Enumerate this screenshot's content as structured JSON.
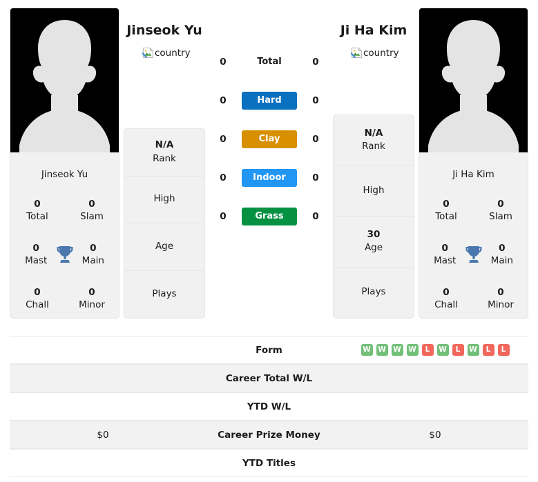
{
  "players": {
    "left": {
      "name": "Jinseok Yu",
      "flag_alt": "country",
      "avatar_name": "player-silhouette",
      "info": [
        {
          "value": "N/A",
          "caption": "Rank"
        },
        {
          "value": "",
          "caption": "High"
        },
        {
          "value": "",
          "caption": "Age"
        },
        {
          "value": "",
          "caption": "Plays"
        }
      ],
      "titles": [
        {
          "value": "0",
          "label": "Total"
        },
        {
          "value": "0",
          "label": "Slam"
        },
        {
          "value": "0",
          "label": "Mast"
        },
        {
          "value": "0",
          "label": "Main"
        },
        {
          "value": "0",
          "label": "Chall"
        },
        {
          "value": "0",
          "label": "Minor"
        }
      ],
      "surface_values": {
        "total": "0",
        "hard": "0",
        "clay": "0",
        "indoor": "0",
        "grass": "0"
      },
      "career_prize_money": "$0",
      "career_total_wl": "",
      "ytd_wl": "",
      "ytd_titles": "",
      "form": []
    },
    "right": {
      "name": "Ji Ha Kim",
      "flag_alt": "country",
      "avatar_name": "player-silhouette",
      "info": [
        {
          "value": "N/A",
          "caption": "Rank"
        },
        {
          "value": "",
          "caption": "High"
        },
        {
          "value": "30",
          "caption": "Age"
        },
        {
          "value": "",
          "caption": "Plays"
        }
      ],
      "titles": [
        {
          "value": "0",
          "label": "Total"
        },
        {
          "value": "0",
          "label": "Slam"
        },
        {
          "value": "0",
          "label": "Mast"
        },
        {
          "value": "0",
          "label": "Main"
        },
        {
          "value": "0",
          "label": "Chall"
        },
        {
          "value": "0",
          "label": "Minor"
        }
      ],
      "surface_values": {
        "total": "0",
        "hard": "0",
        "clay": "0",
        "indoor": "0",
        "grass": "0"
      },
      "career_prize_money": "$0",
      "career_total_wl": "",
      "ytd_wl": "",
      "ytd_titles": "",
      "form": [
        "W",
        "W",
        "W",
        "W",
        "L",
        "W",
        "L",
        "W",
        "L",
        "L"
      ]
    }
  },
  "surfaces": [
    {
      "key": "total",
      "label": "Total",
      "color": "transparent",
      "plain": true
    },
    {
      "key": "hard",
      "label": "Hard",
      "color": "#0a70c0"
    },
    {
      "key": "clay",
      "label": "Clay",
      "color": "#d89000"
    },
    {
      "key": "indoor",
      "label": "Indoor",
      "color": "#2196f3"
    },
    {
      "key": "grass",
      "label": "Grass",
      "color": "#059142"
    }
  ],
  "table_rows": [
    {
      "label": "Form",
      "left": "",
      "right": ""
    },
    {
      "label": "Career Total W/L",
      "left": "",
      "right": ""
    },
    {
      "label": "YTD W/L",
      "left": "",
      "right": ""
    },
    {
      "label": "Career Prize Money",
      "left": "$0",
      "right": "$0"
    },
    {
      "label": "YTD Titles",
      "left": "",
      "right": ""
    }
  ],
  "colors": {
    "win_badge": "#72bf78",
    "loss_badge": "#f1675c",
    "trophy": "#4a77ad",
    "card_bg": "#f1f1f1",
    "row_alt_bg": "#f2f2f2"
  }
}
